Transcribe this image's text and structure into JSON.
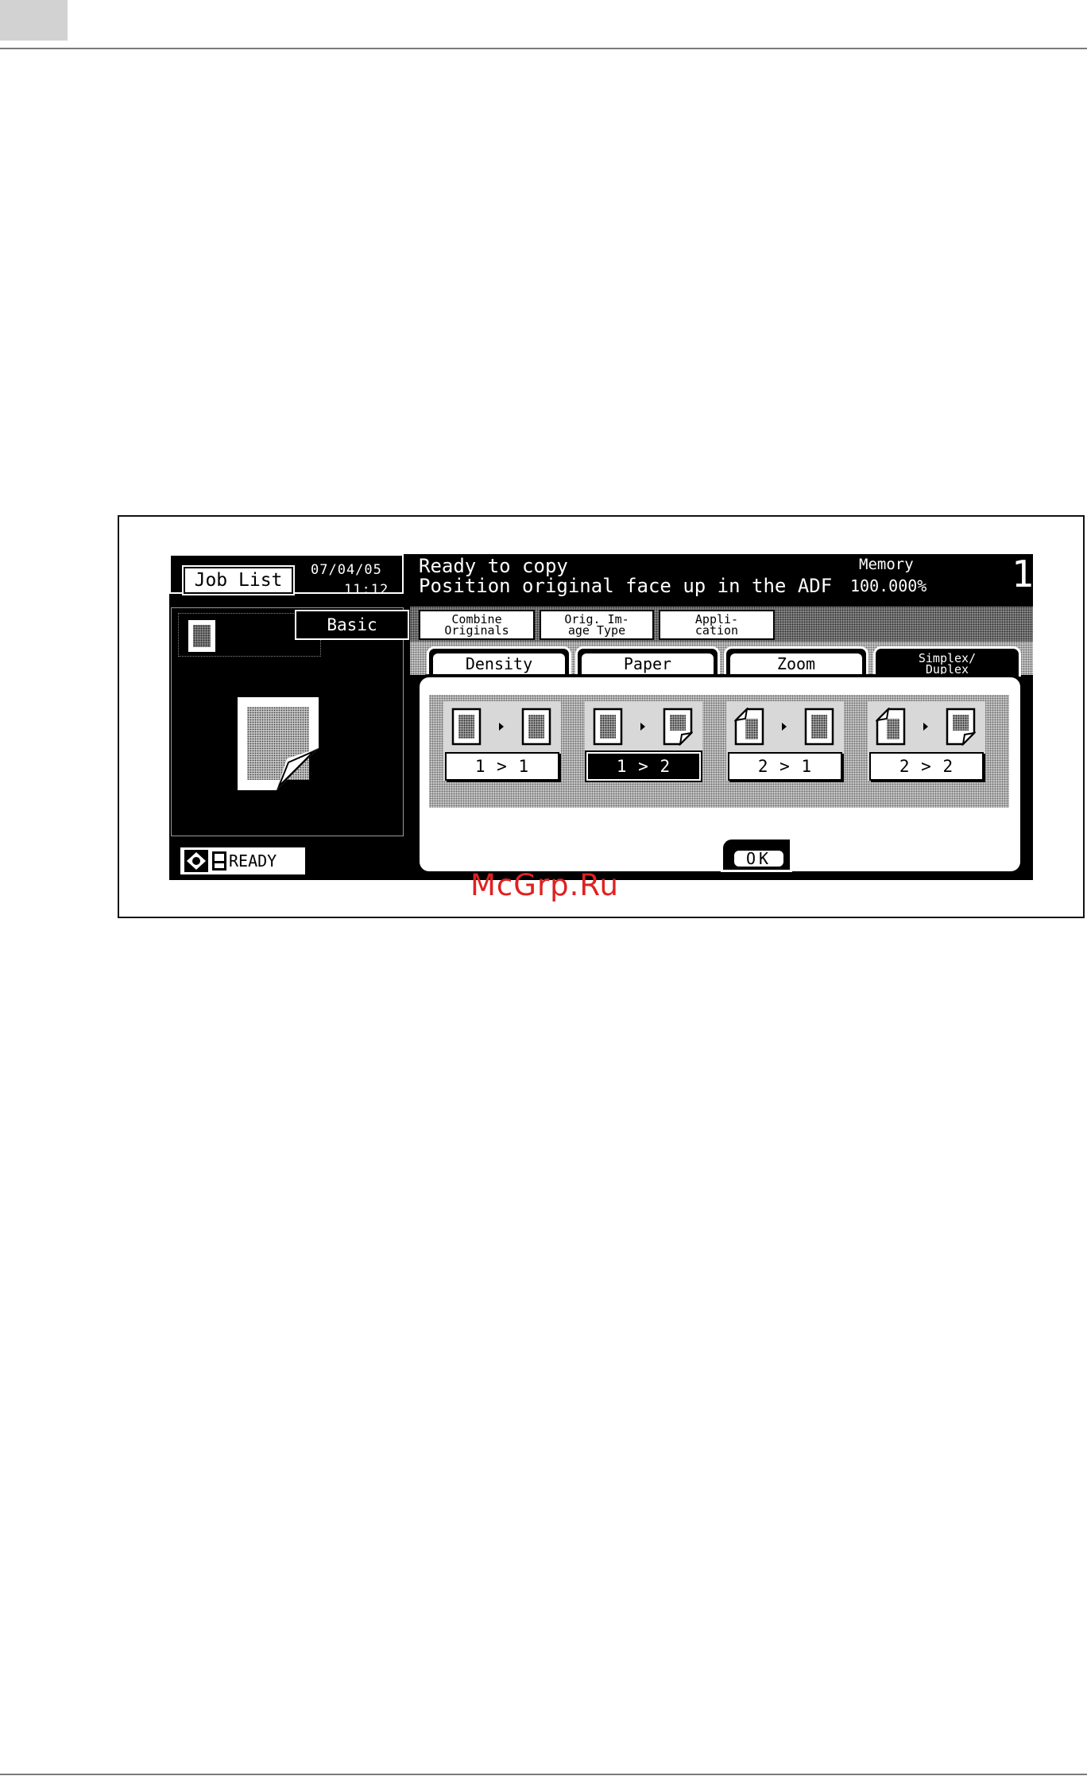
{
  "screen": {
    "header": {
      "job_list_label": "Job List",
      "date": "07/04/05",
      "time": "11:12",
      "message_line1": "Ready to copy",
      "message_line2": "Position original face up in the ADF",
      "memory_label": "Memory",
      "memory_value": "100.000%",
      "copy_count": "1"
    },
    "status": {
      "text": "READY"
    },
    "top_tabs": [
      {
        "label": "Basic",
        "active": true
      },
      {
        "label": "Combine\nOriginals",
        "active": false
      },
      {
        "label": "Orig. Im-\nage Type",
        "active": false
      },
      {
        "label": "Appli-\ncation",
        "active": false
      }
    ],
    "sub_tabs": [
      {
        "label": "Density",
        "active": false
      },
      {
        "label": "Paper",
        "active": false
      },
      {
        "label": "Zoom",
        "active": false
      },
      {
        "label": "Simplex/\nDuplex",
        "active": true
      }
    ],
    "options": [
      {
        "label": "1 > 1",
        "selected": false
      },
      {
        "label": "1 > 2",
        "selected": true
      },
      {
        "label": "2 > 1",
        "selected": false
      },
      {
        "label": "2 > 2",
        "selected": false
      }
    ],
    "ok_label": "OK"
  },
  "watermark": "McGrp.Ru",
  "colors": {
    "screen_bg": "#000000",
    "watermark": "#e02020"
  }
}
